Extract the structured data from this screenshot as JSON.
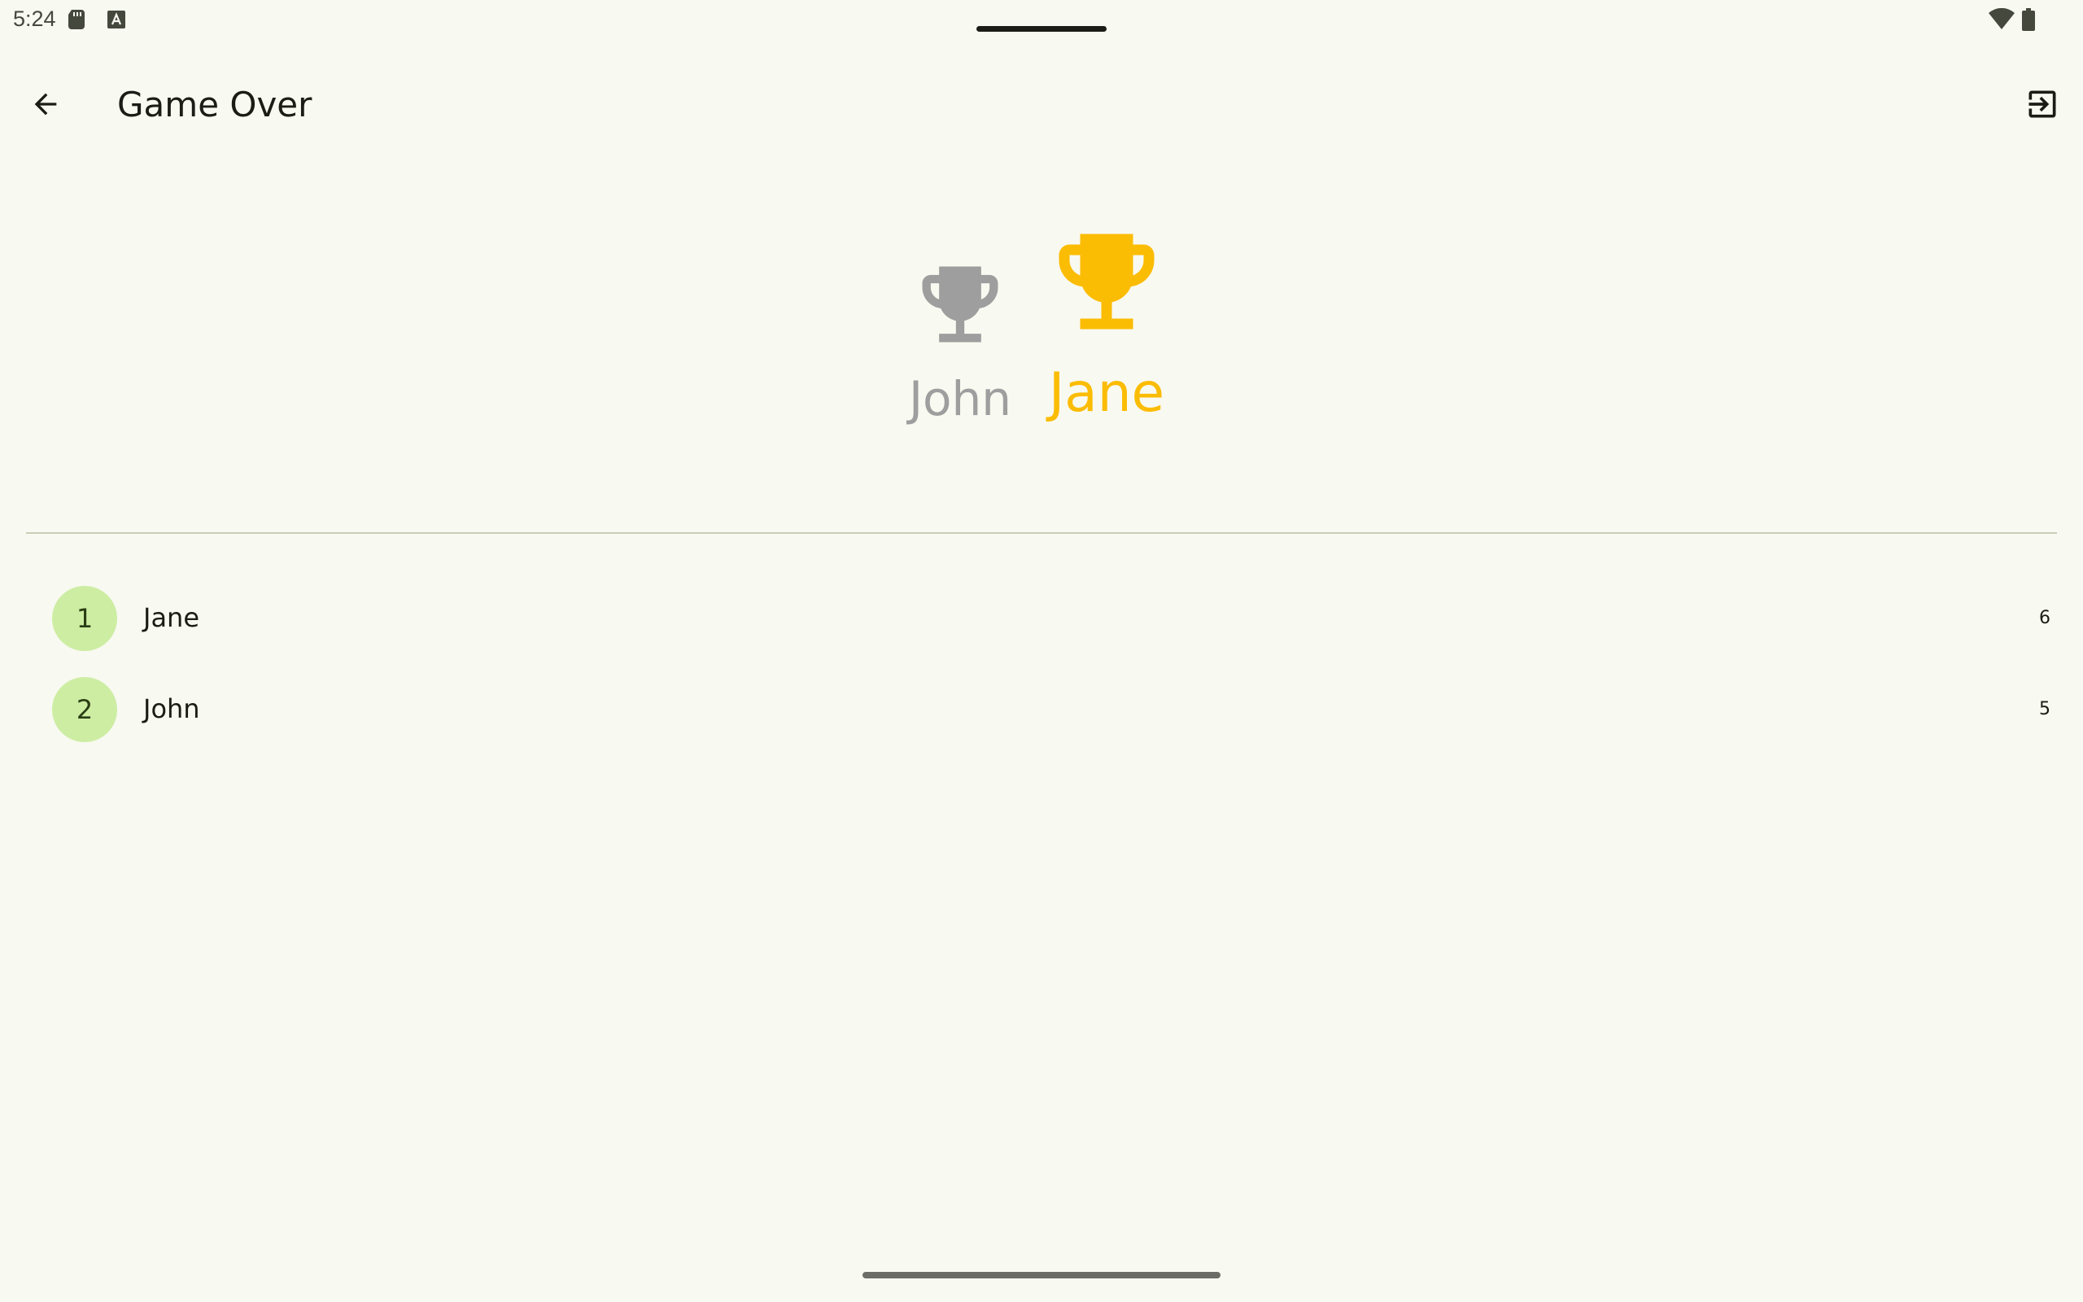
{
  "status_bar": {
    "time": "5:24",
    "icons": [
      "sd-card-icon",
      "a-keyboard-icon",
      "wifi-icon",
      "battery-icon"
    ]
  },
  "app_bar": {
    "title": "Game Over",
    "back_icon": "arrow-back-icon",
    "exit_icon": "exit-icon"
  },
  "podium": {
    "first": {
      "name": "Jane",
      "trophy_color": "#fbbc04"
    },
    "second": {
      "name": "John",
      "trophy_color": "#9e9e9e"
    }
  },
  "scores": [
    {
      "rank": "1",
      "name": "Jane",
      "score": "6"
    },
    {
      "rank": "2",
      "name": "John",
      "score": "5"
    }
  ],
  "colors": {
    "background": "#f8f9f0",
    "rank_badge": "#cdeda3",
    "gold": "#fbbc04",
    "silver": "#9e9e9e"
  }
}
